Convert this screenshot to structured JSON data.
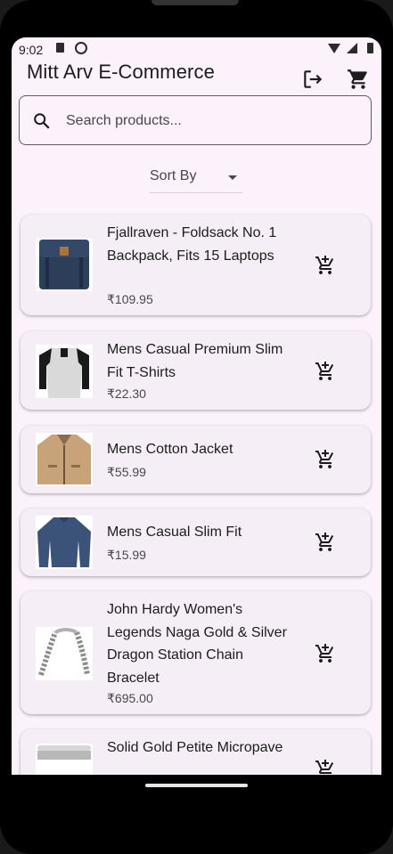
{
  "status": {
    "time": "9:02"
  },
  "app": {
    "title": "Mitt Arv E-Commerce"
  },
  "search": {
    "placeholder": "Search products...",
    "value": ""
  },
  "sort": {
    "label": "Sort By"
  },
  "products": [
    {
      "title": "Fjallraven - Foldsack No. 1 Backpack, Fits 15 Laptops",
      "price": "₹109.95"
    },
    {
      "title": "Mens Casual Premium Slim Fit T-Shirts",
      "price": "₹22.30"
    },
    {
      "title": "Mens Cotton Jacket",
      "price": "₹55.99"
    },
    {
      "title": "Mens Casual Slim Fit",
      "price": "₹15.99"
    },
    {
      "title": "John Hardy Women's Legends Naga Gold & Silver Dragon Station Chain Bracelet",
      "price": "₹695.00"
    },
    {
      "title": "Solid Gold Petite Micropave",
      "price": ""
    }
  ]
}
